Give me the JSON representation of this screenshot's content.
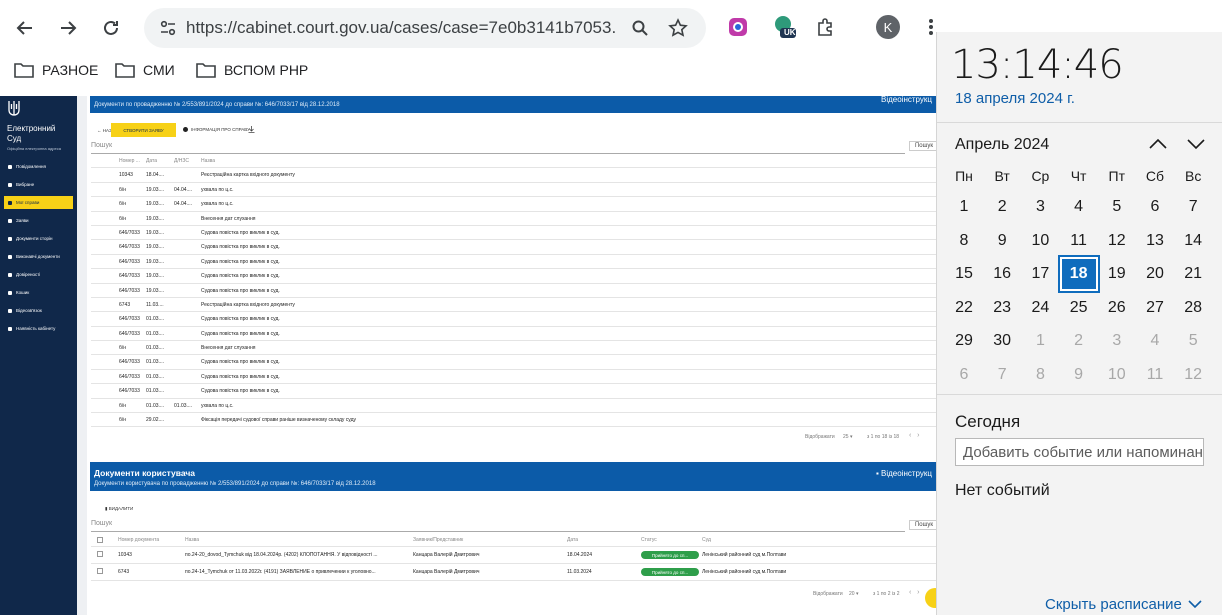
{
  "browser": {
    "url": "https://cabinet.court.gov.ua/cases/case=7e0b3141b7053...",
    "profile_initial": "K",
    "ext_badge": "UK",
    "bookmarks": [
      "РАЗНОЕ",
      "СМИ",
      "ВСПОМ PHP"
    ]
  },
  "sidebar": {
    "brand_line1": "Електронний",
    "brand_line2": "Суд",
    "brand_sub": "Офіційна електронна адреса",
    "items": [
      "Повідомлення",
      "Вибране",
      "Мої справи",
      "Заяви",
      "Документи сторін",
      "Виконавчі документи",
      "Довіреності",
      "Кошик",
      "Відеозв'язок",
      "Наявність кабінету"
    ]
  },
  "docs_panel": {
    "subtitle": "Документи по провадженню № 2/553/891/2024 до справи №: 646/7033/17 від 28.12.2018",
    "video": "Відеоінструкц",
    "back": "← НАЗАД",
    "download_all": "СТВОРИТИ ЗАЯВУ",
    "info": "ІНФОРМАЦІЯ ПРО СПРАВУ",
    "search_placeholder": "Пошук",
    "search_btn": "Пошук",
    "columns": [
      "Номер ...",
      "Дата",
      "Д/НЗС",
      "Назва"
    ],
    "rows": [
      [
        "10343",
        "18.04....",
        "",
        "Реєстраційна картка вхідного документу"
      ],
      [
        "б/н",
        "19.03....",
        "04.04....",
        "ухвала по ц.с."
      ],
      [
        "б/н",
        "19.03....",
        "04.04....",
        "ухвала по ц.с."
      ],
      [
        "б/н",
        "19.03....",
        "",
        "Внесення дат слухання"
      ],
      [
        "646/7033",
        "19.03....",
        "",
        "Судова повістка про виклик в суд."
      ],
      [
        "646/7033",
        "19.03....",
        "",
        "Судова повістка про виклик в суд."
      ],
      [
        "646/7033",
        "19.03....",
        "",
        "Судова повістка про виклик в суд."
      ],
      [
        "646/7033",
        "19.03....",
        "",
        "Судова повістка про виклик в суд."
      ],
      [
        "646/7033",
        "19.03....",
        "",
        "Судова повістка про виклик в суд."
      ],
      [
        "6743",
        "11.03....",
        "",
        "Реєстраційна картка вхідного документу"
      ],
      [
        "646/7033",
        "01.03....",
        "",
        "Судова повістка про виклик в суд."
      ],
      [
        "646/7033",
        "01.03....",
        "",
        "Судова повістка про виклик в суд."
      ],
      [
        "б/н",
        "01.03....",
        "",
        "Внесення дат слухання"
      ],
      [
        "646/7033",
        "01.03....",
        "",
        "Судова повістка про виклик в суд."
      ],
      [
        "646/7033",
        "01.03....",
        "",
        "Судова повістка про виклик в суд."
      ],
      [
        "646/7033",
        "01.03....",
        "",
        "Судова повістка про виклик в суд."
      ],
      [
        "б/н",
        "01.03....",
        "01.03....",
        "ухвала по ц.с."
      ],
      [
        "б/н",
        "29.02....",
        "",
        "Фіксація передачі судової справи раніше визначеному складу суду"
      ]
    ],
    "pager_label": "Відображати",
    "pager_size": "25 ▾",
    "pager_range": "з 1 по 18 із 18"
  },
  "user_panel": {
    "title": "Документи користувача",
    "subtitle": "Документи користувача по провадженню № 2/553/891/2024 до справи №: 646/7033/17 від 28.12.2018",
    "video": "Відеоінструкц",
    "action": "ВИДАЛИТИ",
    "search_placeholder": "Пошук",
    "search_btn": "Пошук",
    "columns": [
      "Номер документа",
      "Назва",
      "Заявник/Представник",
      "Дата",
      "Статус",
      "Суд"
    ],
    "rows": [
      [
        "10343",
        "по.24-20_dovod_Tymchuk від 18.04.2024р. (4202) КЛОПОТАННЯ. У відповідності ...",
        "Канцара Валерій Дмитрович",
        "18.04.2024",
        "Прийнято до сп...",
        "Ленінський районний суд м.Полтави"
      ],
      [
        "6743",
        "по.24-14_Tymchuk от 11.03.2022г. (4191) ЗАЯВЛЕНИЕ о привлечении к уголовно...",
        "Канцара Валерій Дмитрович",
        "11.03.2024",
        "Прийнято до сп...",
        "Ленінський районний суд м.Полтави"
      ]
    ],
    "pager_label": "Відображати",
    "pager_size": "20 ▾",
    "pager_range": "з 1 по 2 із 2"
  },
  "flyout": {
    "time": "13:14:46",
    "date_long": "18 апреля 2024 г.",
    "month": "Апрель 2024",
    "weekdays": [
      "Пн",
      "Вт",
      "Ср",
      "Чт",
      "Пт",
      "Сб",
      "Вс"
    ],
    "weeks": [
      [
        "1",
        "2",
        "3",
        "4",
        "5",
        "6",
        "7"
      ],
      [
        "8",
        "9",
        "10",
        "11",
        "12",
        "13",
        "14"
      ],
      [
        "15",
        "16",
        "17",
        "18",
        "19",
        "20",
        "21"
      ],
      [
        "22",
        "23",
        "24",
        "25",
        "26",
        "27",
        "28"
      ],
      [
        "29",
        "30",
        "1",
        "2",
        "3",
        "4",
        "5"
      ],
      [
        "6",
        "7",
        "8",
        "9",
        "10",
        "11",
        "12"
      ]
    ],
    "today_label": "Сегодня",
    "event_placeholder": "Добавить событие или напоминание",
    "no_events": "Нет событий",
    "hide_schedule": "Скрыть расписание",
    "accent": "#0f6cbd"
  }
}
